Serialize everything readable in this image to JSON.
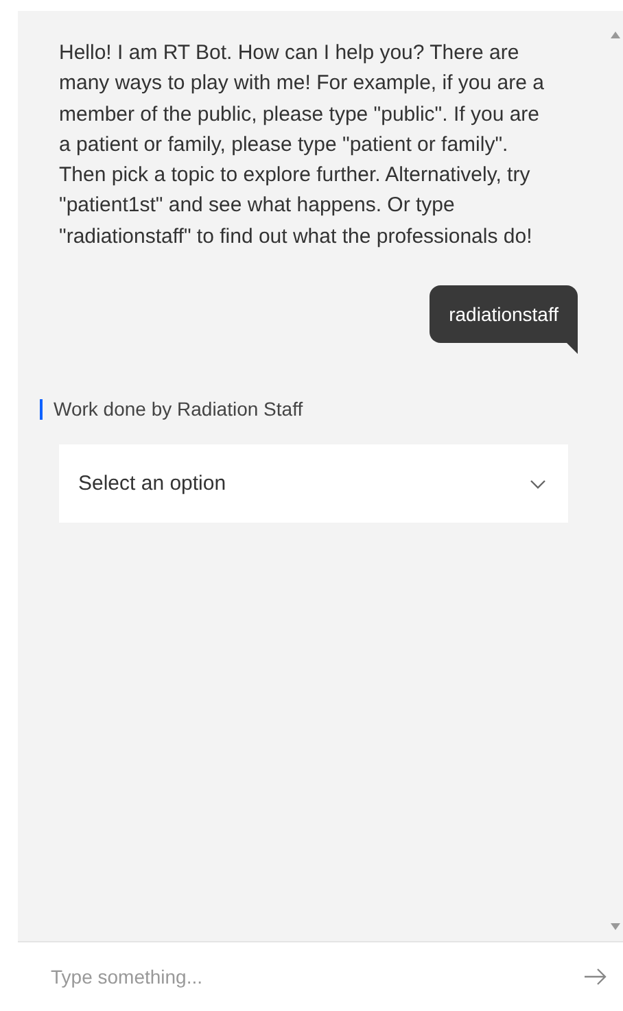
{
  "messages": [
    {
      "kind": "bot",
      "text": "Hello! I am RT Bot. How can I help you? There are many ways to play with me! For example, if you are a member of the public, please type \"public\". If you are a patient or family, please type \"patient or family\". Then pick a topic to explore further. Alternatively, try \"patient1st\" and see what happens. Or type \"radiationstaff\" to find out what the professionals do!"
    },
    {
      "kind": "user",
      "text": "radiationstaff"
    },
    {
      "kind": "options",
      "label": "Work done by Radiation Staff",
      "placeholder": "Select an option"
    }
  ],
  "input": {
    "placeholder": "Type something..."
  }
}
